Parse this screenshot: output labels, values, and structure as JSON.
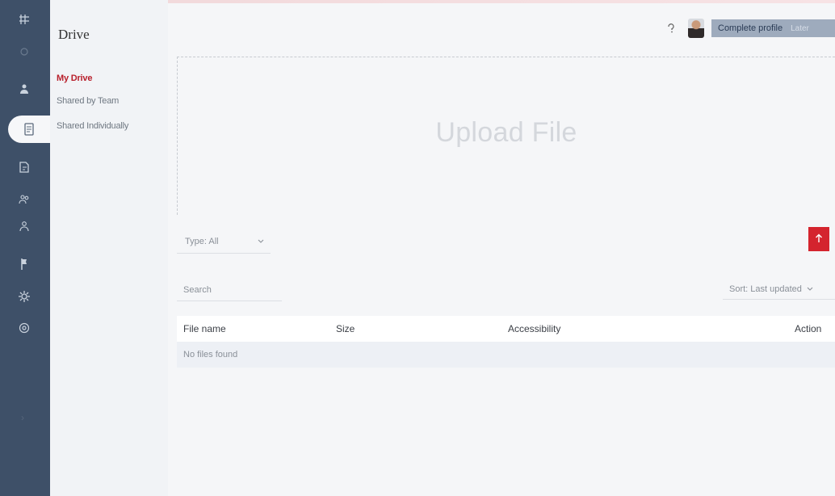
{
  "rail": {
    "icons": [
      "grid-icon",
      "home-icon",
      "users-icon",
      "drive-icon",
      "book-icon",
      "team-icon",
      "people-icon",
      "flag-icon",
      "settings-icon",
      "support-icon",
      "expand-icon"
    ]
  },
  "side": {
    "title": "Drive",
    "links": [
      {
        "label": "My Drive",
        "active": true
      },
      {
        "label": "Shared by Team",
        "active": false
      },
      {
        "label": "Shared Individually",
        "active": false
      }
    ]
  },
  "header": {
    "notification_icon": "help-icon",
    "profile_button": "Complete profile",
    "profile_secondary": "Later"
  },
  "upload": {
    "label": "Upload File"
  },
  "filters": {
    "type_selected": "Type: All",
    "search_placeholder": "Search",
    "sort_selected": "Sort: Last updated"
  },
  "table": {
    "columns": [
      "File name",
      "Size",
      "Accessibility",
      "Action"
    ],
    "empty_message": "No files found"
  },
  "colors": {
    "rail": "#3e5068",
    "accent": "#b81f2b",
    "button_red": "#d4242e",
    "profile_button": "#9eabbd"
  }
}
